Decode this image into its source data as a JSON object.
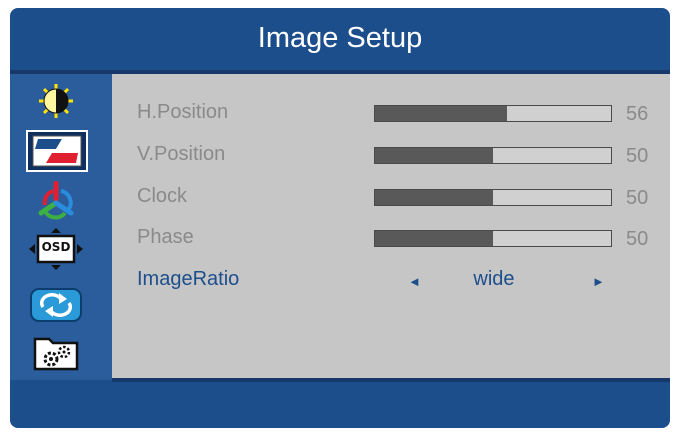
{
  "title": "Image Setup",
  "sidebar": {
    "tabs": [
      {
        "icon": "brightness-icon",
        "active": false
      },
      {
        "icon": "image-setup-icon",
        "active": true
      },
      {
        "icon": "color-icon",
        "active": false
      },
      {
        "icon": "osd-icon",
        "active": false
      },
      {
        "icon": "reset-icon",
        "active": false
      },
      {
        "icon": "extra-settings-icon",
        "active": false
      }
    ],
    "osd_icon_text": "OSD"
  },
  "rows": [
    {
      "label": "H.Position",
      "value": "56",
      "level": 56
    },
    {
      "label": "V.Position",
      "value": "50",
      "level": 50
    },
    {
      "label": "Clock",
      "value": "50",
      "level": 50
    },
    {
      "label": "Phase",
      "value": "50",
      "level": 50
    }
  ],
  "image_ratio": {
    "label": "ImageRatio",
    "value": "wide",
    "left_arrow": "◄",
    "right_arrow": "►"
  },
  "colors": {
    "accent": "#1d4e8c",
    "panel": "#c6c6c6",
    "bar_fill": "#595959"
  }
}
